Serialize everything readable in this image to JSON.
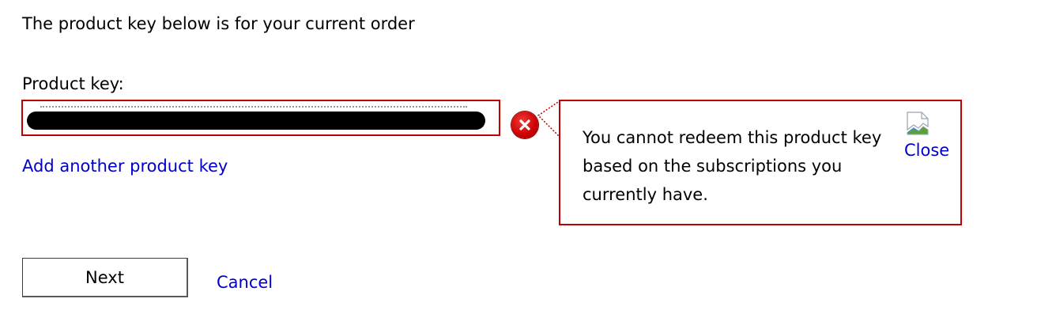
{
  "intro_text": "The product key below is for your current order",
  "product_key": {
    "label": "Product key:",
    "value_redacted": true
  },
  "error": {
    "icon": "error-x-icon",
    "message": "You cannot redeem this product key based on the subscriptions you currently have.",
    "close_image_icon": "broken-image-icon",
    "close_label": "Close"
  },
  "links": {
    "add_another": "Add another product key",
    "cancel": "Cancel"
  },
  "buttons": {
    "next": "Next"
  },
  "colors": {
    "error_border": "#c00000",
    "link": "#0000cc",
    "error_icon": "#cc0000"
  }
}
